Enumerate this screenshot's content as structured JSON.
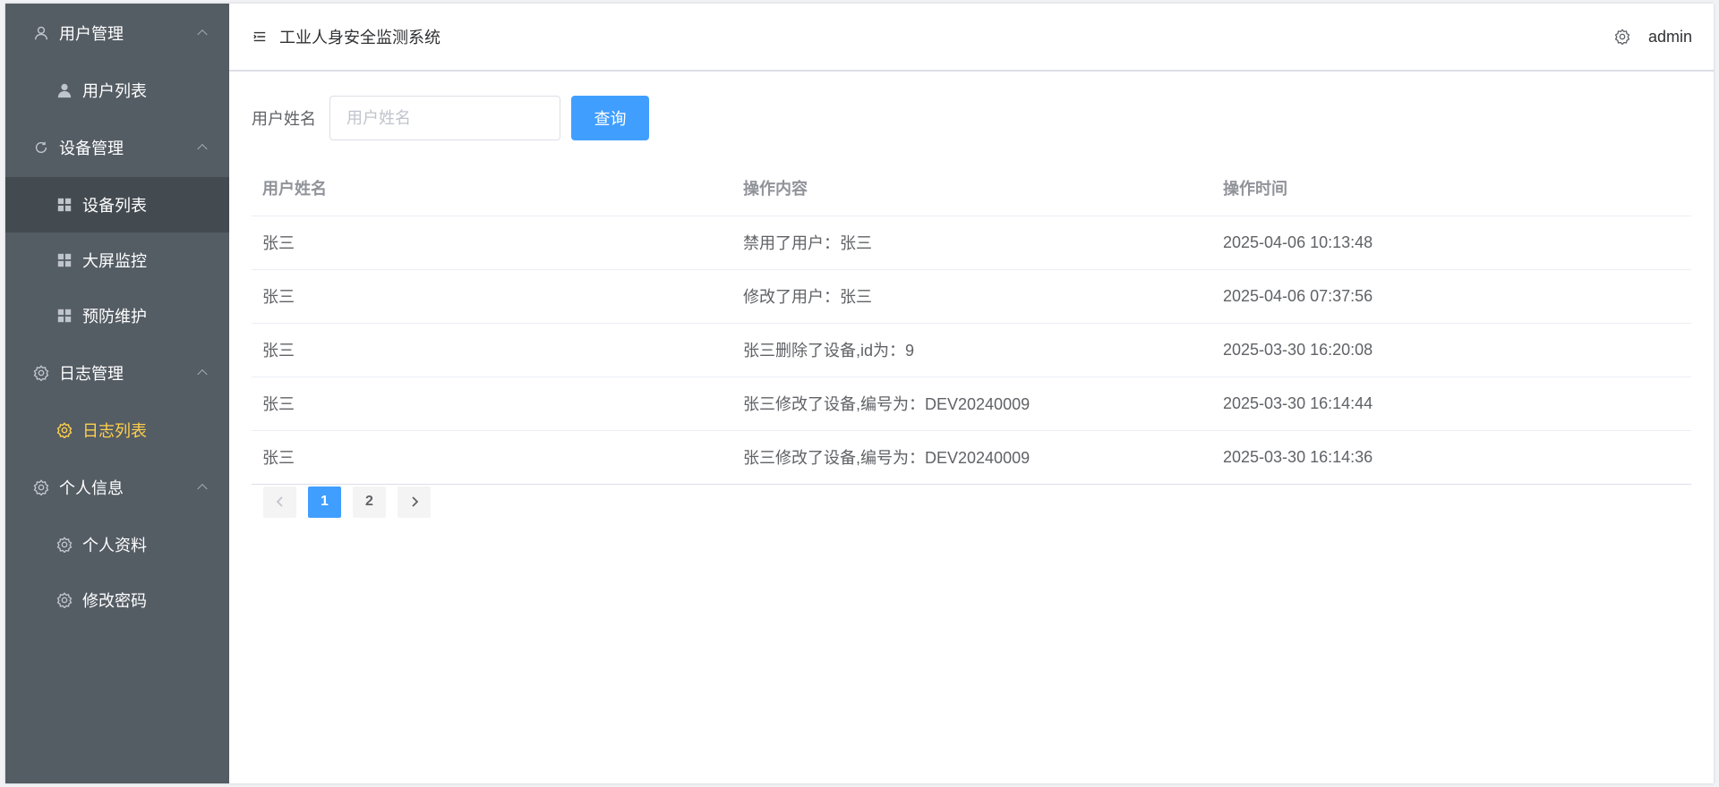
{
  "app": {
    "title": "工业人身安全监测系统",
    "user": "admin"
  },
  "sidebar": {
    "groups": [
      {
        "title": "用户管理",
        "icon": "user-icon",
        "items": [
          {
            "label": "用户列表",
            "icon": "person-icon"
          }
        ]
      },
      {
        "title": "设备管理",
        "icon": "refresh-icon",
        "items": [
          {
            "label": "设备列表",
            "icon": "grid-icon"
          },
          {
            "label": "大屏监控",
            "icon": "grid-icon"
          },
          {
            "label": "预防维护",
            "icon": "grid-icon"
          }
        ]
      },
      {
        "title": "日志管理",
        "icon": "gear-icon",
        "items": [
          {
            "label": "日志列表",
            "icon": "gear-icon"
          }
        ]
      },
      {
        "title": "个人信息",
        "icon": "gear-icon",
        "items": [
          {
            "label": "个人资料",
            "icon": "gear-icon"
          },
          {
            "label": "修改密码",
            "icon": "gear-icon"
          }
        ]
      }
    ],
    "active_item": "日志列表",
    "highlight_item": "设备列表",
    "colors": {
      "background": "#545c64",
      "active_text": "#ffd04b",
      "highlight_bg": "#434a50"
    }
  },
  "search": {
    "label": "用户姓名",
    "placeholder": "用户姓名",
    "value": "",
    "button_label": "查询"
  },
  "table": {
    "columns": [
      "用户姓名",
      "操作内容",
      "操作时间"
    ],
    "rows": [
      [
        "张三",
        "禁用了用户：张三",
        "2025-04-06 10:13:48"
      ],
      [
        "张三",
        "修改了用户：张三",
        "2025-04-06 07:37:56"
      ],
      [
        "张三",
        "张三删除了设备,id为：9",
        "2025-03-30 16:20:08"
      ],
      [
        "张三",
        "张三修改了设备,编号为：DEV20240009",
        "2025-03-30 16:14:44"
      ],
      [
        "张三",
        "张三修改了设备,编号为：DEV20240009",
        "2025-03-30 16:14:36"
      ]
    ]
  },
  "pagination": {
    "pages": [
      "1",
      "2"
    ],
    "current": "1",
    "accent": "#409eff"
  }
}
